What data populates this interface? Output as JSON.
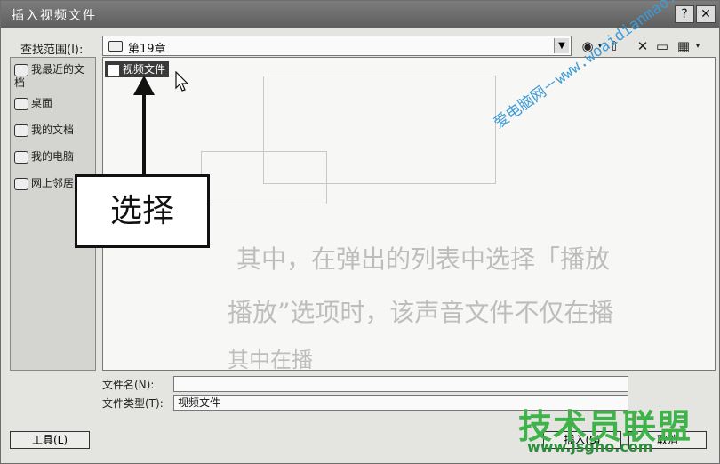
{
  "window": {
    "title": "插入视频文件",
    "help_label": "?",
    "close_label": "✕"
  },
  "lookin": {
    "label": "查找范围(I):",
    "path": "第19章"
  },
  "toolbar": {
    "back_icon": "back-icon",
    "up_icon": "up-folder-icon",
    "delete_icon": "delete-icon",
    "newfolder_icon": "new-folder-icon",
    "views_icon": "views-icon"
  },
  "places": [
    {
      "label": "我最近的文档"
    },
    {
      "label": "桌面"
    },
    {
      "label": "我的文档"
    },
    {
      "label": "我的电脑"
    },
    {
      "label": "网上邻居"
    }
  ],
  "file": {
    "name": "视频文件"
  },
  "callout": {
    "text": "选择"
  },
  "background_text": {
    "line1": "其中，在弹出的列表中选择「播放",
    "line2": "播放”选项时，该声音文件不仅在播",
    "line3": "其中在播"
  },
  "filename": {
    "label": "文件名(N):",
    "value": ""
  },
  "filetype": {
    "label": "文件类型(T):",
    "value": "视频文件"
  },
  "buttons": {
    "tools": "工具(L)",
    "open": "插入(S)",
    "cancel": "取消"
  },
  "watermark": {
    "url": "爱电脑网－www.woaidianmao.com",
    "brand": "技术员联盟",
    "site": "www.jsgho.com"
  },
  "colors": {
    "watermark_blue": "#3d9ad6",
    "watermark_green": "#3fb24a"
  }
}
